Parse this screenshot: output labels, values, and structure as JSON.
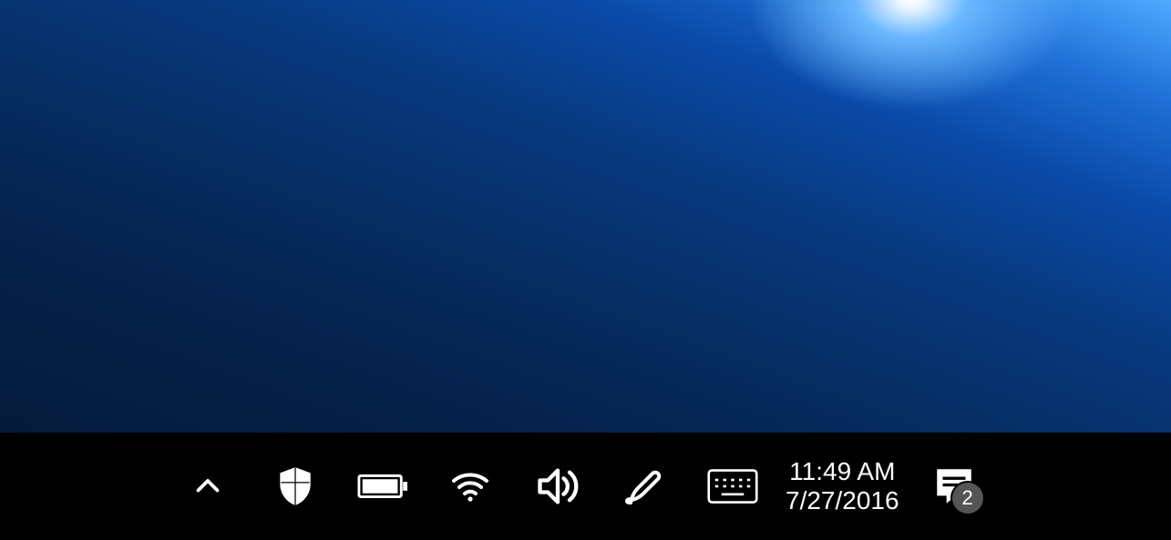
{
  "desktop": {
    "name": "windows-desktop"
  },
  "taskbar": {
    "tray_items": [
      {
        "name": "show-hidden-icons",
        "icon": "chevron-up-icon"
      },
      {
        "name": "windows-defender",
        "icon": "shield-icon"
      },
      {
        "name": "battery",
        "icon": "battery-icon"
      },
      {
        "name": "wifi",
        "icon": "wifi-icon"
      },
      {
        "name": "volume",
        "icon": "speaker-icon"
      },
      {
        "name": "pen-ink",
        "icon": "pen-icon"
      },
      {
        "name": "touch-keyboard",
        "icon": "keyboard-icon"
      }
    ],
    "clock": {
      "time": "11:49 AM",
      "date": "7/27/2016"
    },
    "action_center": {
      "name": "action-center",
      "icon": "notification-icon",
      "badge": "2"
    }
  }
}
